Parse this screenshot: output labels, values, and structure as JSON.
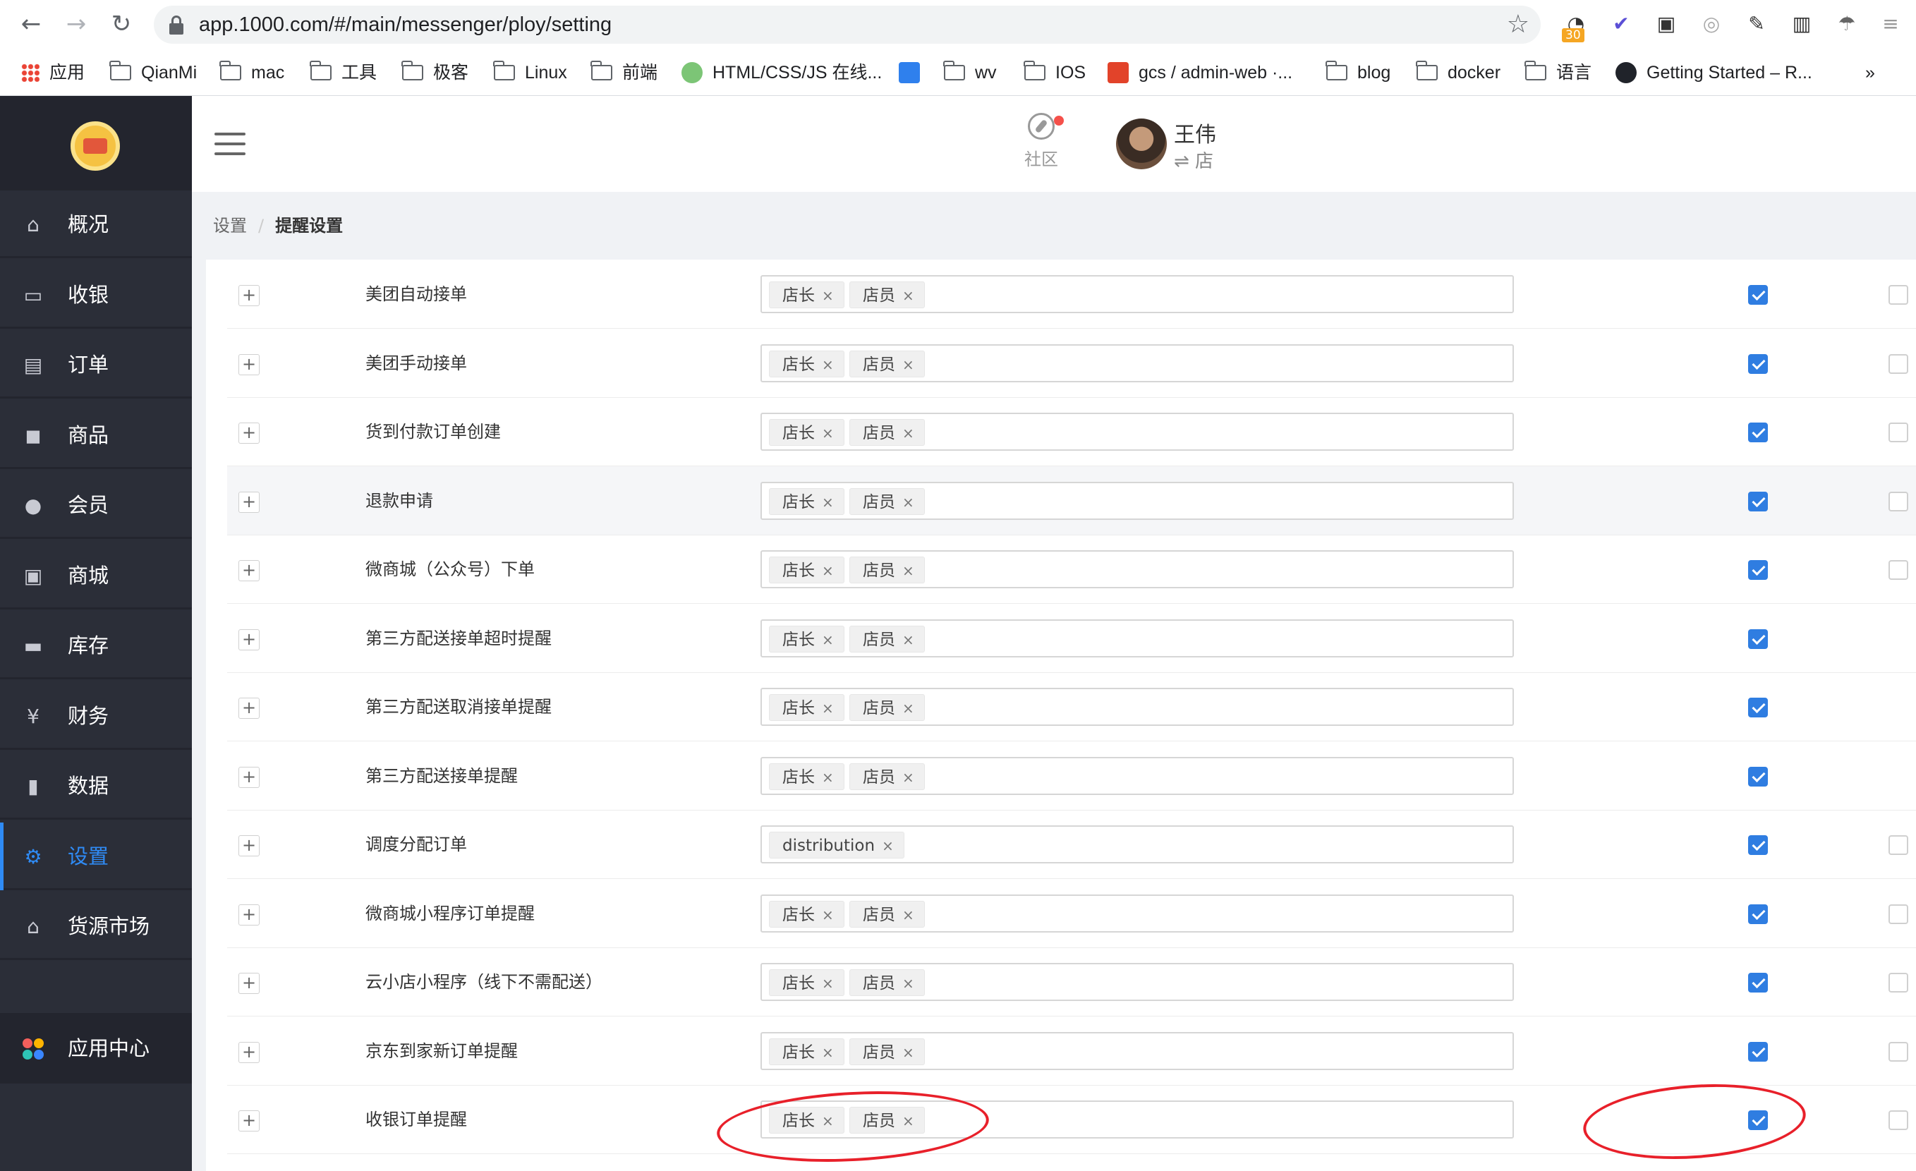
{
  "browser": {
    "url": "app.1000.com/#/main/messenger/ploy/setting",
    "ext_badge": "30",
    "bookmarks": [
      "应用",
      "QianMi",
      "mac",
      "工具",
      "极客",
      "Linux",
      "前端",
      "HTML/CSS/JS 在线...",
      "wv",
      "IOS",
      "gcs / admin-web ·...",
      "blog",
      "docker",
      "语言",
      "Getting Started – R..."
    ],
    "more": "»"
  },
  "sidebar": {
    "items": [
      {
        "label": "概况",
        "icon": "home-icon"
      },
      {
        "label": "收银",
        "icon": "cashier-icon"
      },
      {
        "label": "订单",
        "icon": "order-icon"
      },
      {
        "label": "商品",
        "icon": "bag-icon"
      },
      {
        "label": "会员",
        "icon": "user-icon"
      },
      {
        "label": "商城",
        "icon": "shop-icon"
      },
      {
        "label": "库存",
        "icon": "inbox-icon"
      },
      {
        "label": "财务",
        "icon": "yen-icon"
      },
      {
        "label": "数据",
        "icon": "bar-chart-icon"
      },
      {
        "label": "设置",
        "icon": "gear-icon"
      },
      {
        "label": "货源市场",
        "icon": "warehouse-icon"
      }
    ],
    "active_index": 9,
    "app_center": "应用中心"
  },
  "header": {
    "community": "社区",
    "user_name": "王伟",
    "user_store": "⇌ 店"
  },
  "breadcrumb": {
    "parent": "设置",
    "separator": "/",
    "current": "提醒设置"
  },
  "tag_remove": "×",
  "expand_symbol": "+",
  "rows": [
    {
      "name": "美团自动接单",
      "tags": [
        "店长",
        "店员"
      ],
      "checked": true,
      "second": false
    },
    {
      "name": "美团手动接单",
      "tags": [
        "店长",
        "店员"
      ],
      "checked": true,
      "second": false
    },
    {
      "name": "货到付款订单创建",
      "tags": [
        "店长",
        "店员"
      ],
      "checked": true,
      "second": false
    },
    {
      "name": "退款申请",
      "tags": [
        "店长",
        "店员"
      ],
      "checked": true,
      "second": false
    },
    {
      "name": "微商城（公众号）下单",
      "tags": [
        "店长",
        "店员"
      ],
      "checked": true,
      "second": false
    },
    {
      "name": "第三方配送接单超时提醒",
      "tags": [
        "店长",
        "店员"
      ],
      "checked": true,
      "second": null
    },
    {
      "name": "第三方配送取消接单提醒",
      "tags": [
        "店长",
        "店员"
      ],
      "checked": true,
      "second": null
    },
    {
      "name": "第三方配送接单提醒",
      "tags": [
        "店长",
        "店员"
      ],
      "checked": true,
      "second": null
    },
    {
      "name": "调度分配订单",
      "tags": [
        "distribution"
      ],
      "checked": true,
      "second": false
    },
    {
      "name": "微商城小程序订单提醒",
      "tags": [
        "店长",
        "店员"
      ],
      "checked": true,
      "second": false
    },
    {
      "name": "云小店小程序（线下不需配送）",
      "tags": [
        "店长",
        "店员"
      ],
      "checked": true,
      "second": false
    },
    {
      "name": "京东到家新订单提醒",
      "tags": [
        "店长",
        "店员"
      ],
      "checked": true,
      "second": false
    },
    {
      "name": "收银订单提醒",
      "tags": [
        "店长",
        "店员"
      ],
      "checked": true,
      "second": false
    }
  ],
  "colors": {
    "accent": "#2f7de1",
    "sidebar": "#2b2e38",
    "annotation": "#e8202a"
  }
}
